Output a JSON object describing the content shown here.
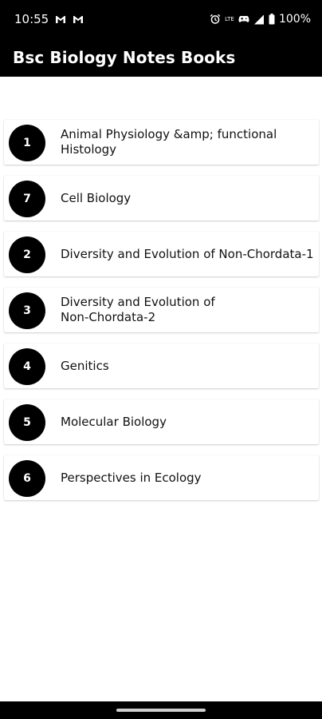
{
  "status_bar": {
    "time": "10:55",
    "battery_percent": "100%",
    "network_type": "LTE",
    "left_icons": [
      "gmail-icon",
      "gmail-icon"
    ],
    "right_icons": [
      "alarm-icon",
      "lte-icon",
      "gamepad-icon",
      "signal-icon",
      "battery-icon"
    ]
  },
  "app_bar": {
    "title": "Bsc Biology Notes Books"
  },
  "books": [
    {
      "number": "1",
      "title": "Animal Physiology &amp; functional\nHistology"
    },
    {
      "number": "7",
      "title": "Cell Biology"
    },
    {
      "number": "2",
      "title": "Diversity and Evolution of Non-Chordata-1"
    },
    {
      "number": "3",
      "title": "Diversity and Evolution of\nNon-Chordata-2"
    },
    {
      "number": "4",
      "title": "Genitics"
    },
    {
      "number": "5",
      "title": "Molecular Biology"
    },
    {
      "number": "6",
      "title": "Perspectives in Ecology"
    }
  ],
  "colors": {
    "bar_background": "#000000",
    "badge_background": "#000000",
    "page_background": "#ffffff"
  }
}
